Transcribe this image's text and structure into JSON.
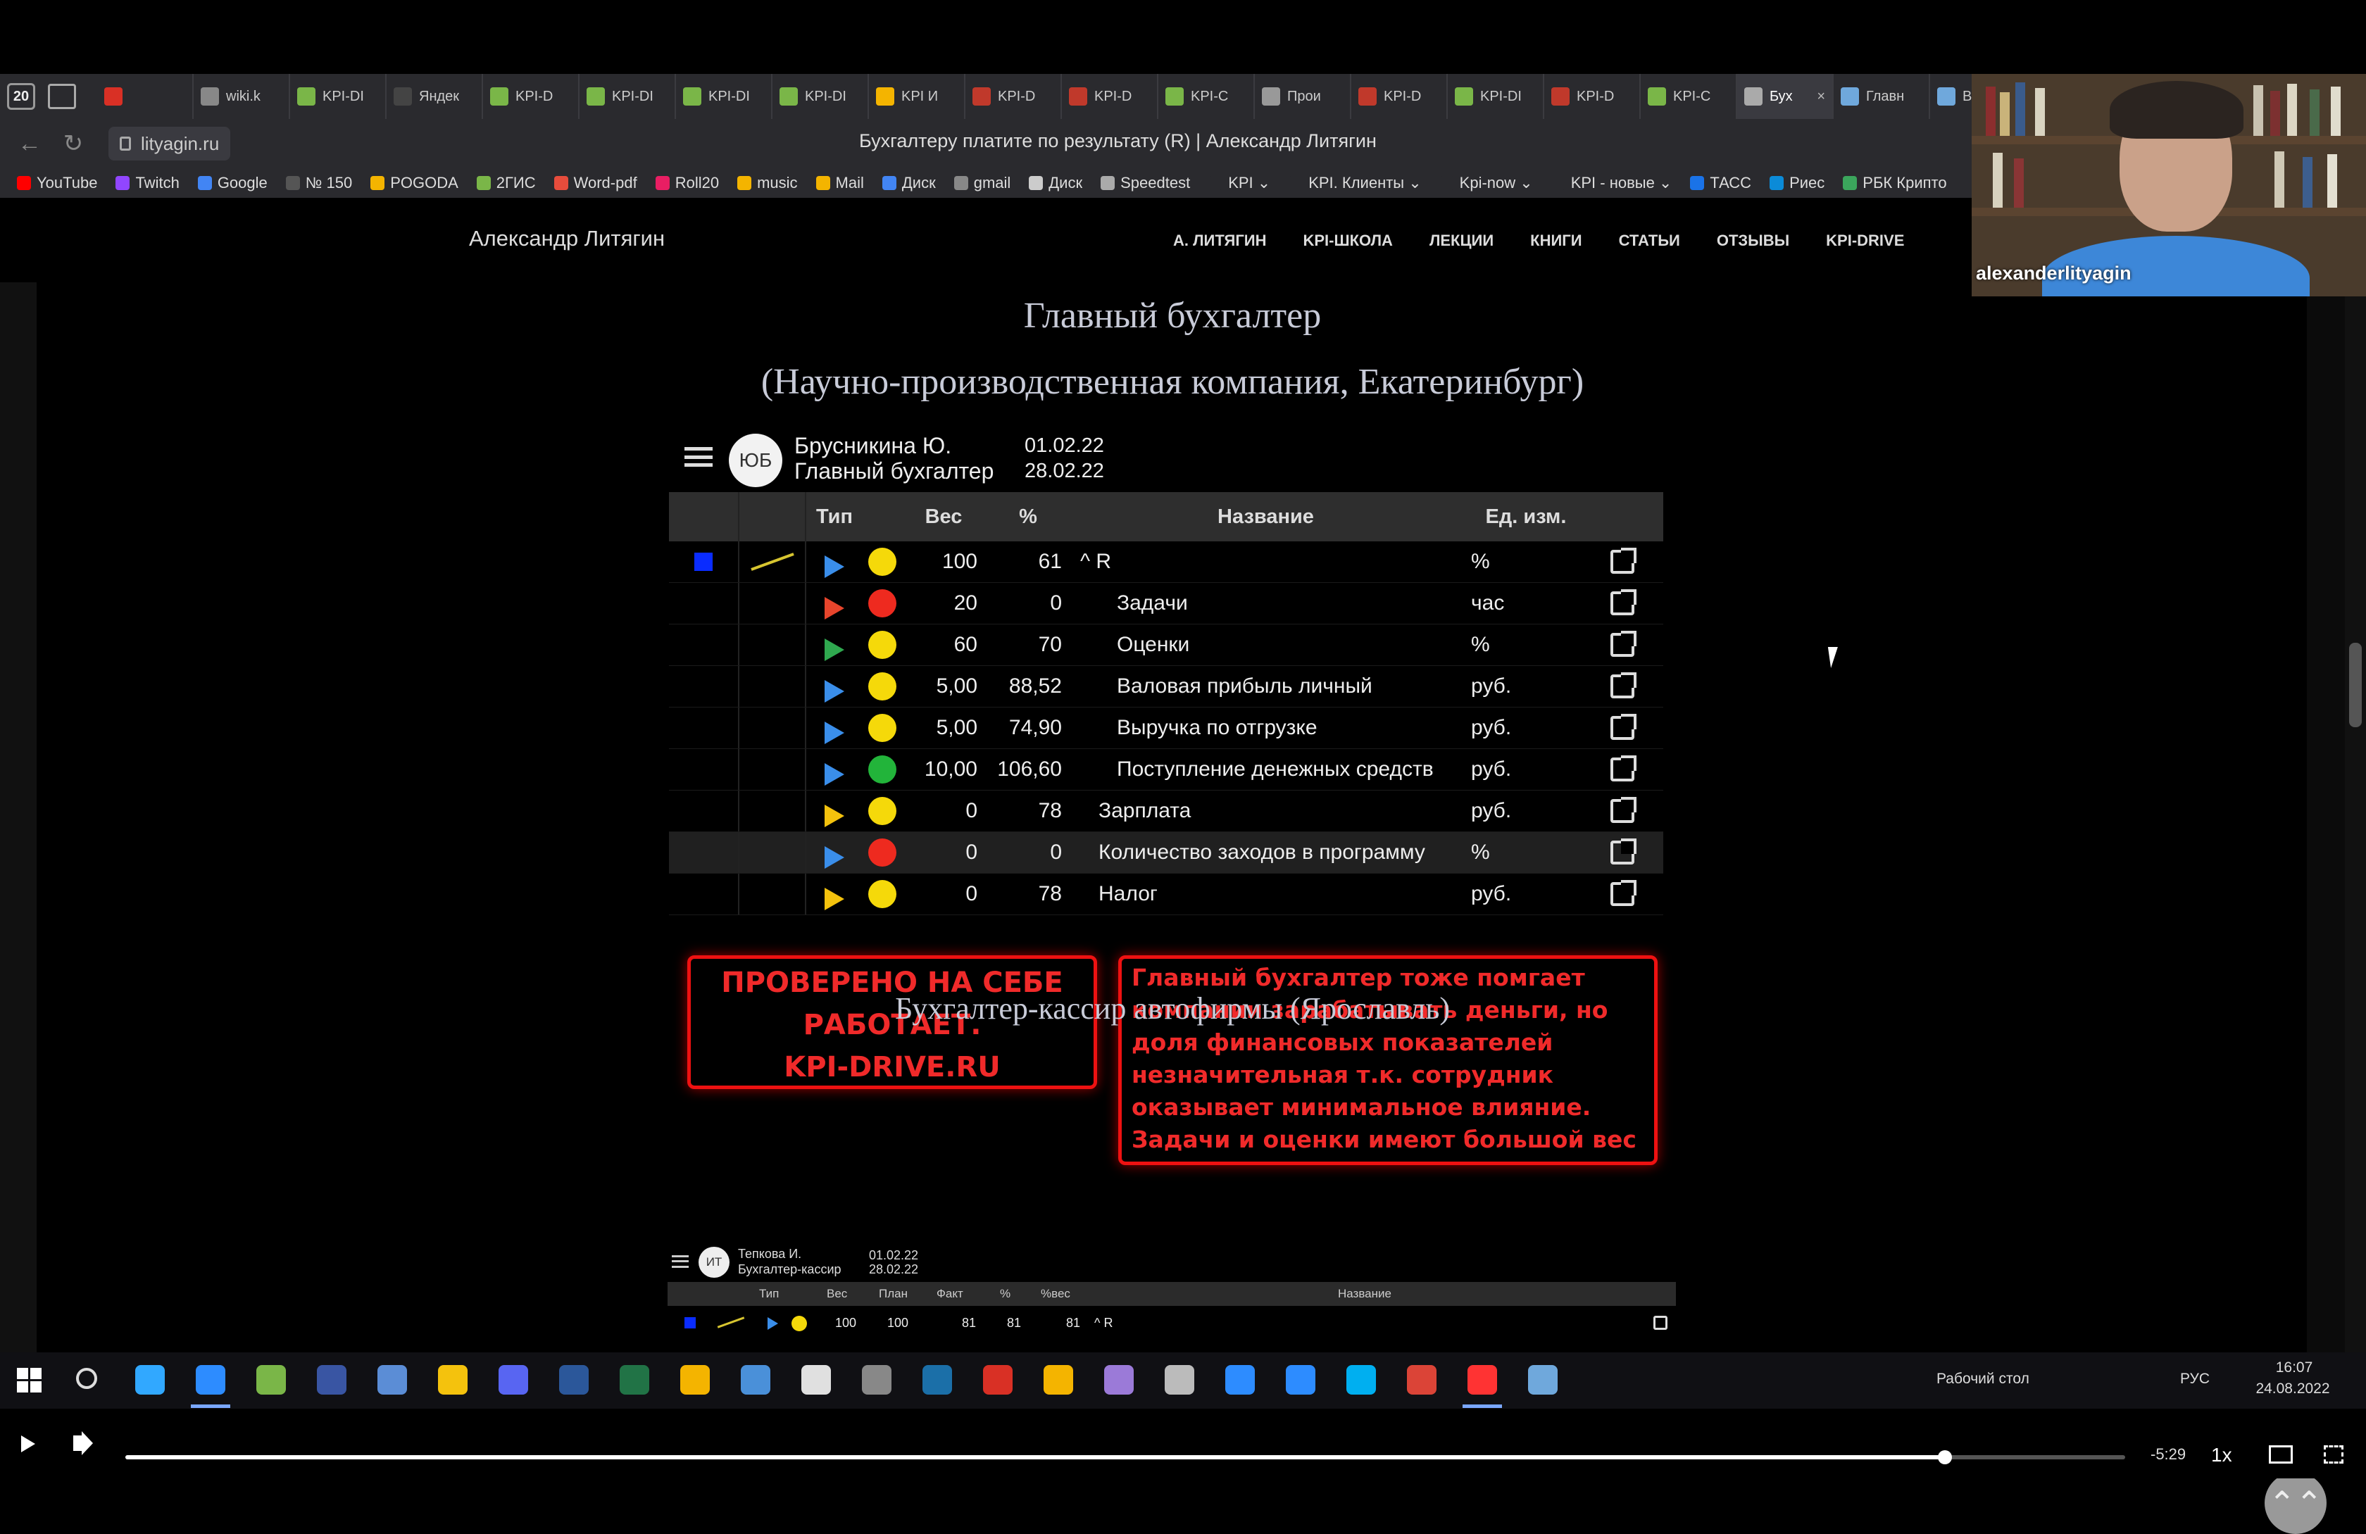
{
  "browser": {
    "tab_count": "20",
    "tabs": [
      {
        "label": "",
        "color": "#d93025"
      },
      {
        "label": "wiki.k",
        "color": "#888888"
      },
      {
        "label": "KPI-DI",
        "color": "#7ab648"
      },
      {
        "label": "Яндек",
        "color": "#444444"
      },
      {
        "label": "KPI-D",
        "color": "#7ab648"
      },
      {
        "label": "KPI-DI",
        "color": "#7ab648"
      },
      {
        "label": "KPI-DI",
        "color": "#7ab648"
      },
      {
        "label": "KPI-DI",
        "color": "#7ab648"
      },
      {
        "label": "KPI И",
        "color": "#f4b400"
      },
      {
        "label": "KPI-D",
        "color": "#c0392b"
      },
      {
        "label": "KPI-D",
        "color": "#c0392b"
      },
      {
        "label": "KPI-C",
        "color": "#7ab648"
      },
      {
        "label": "Прои",
        "color": "#999999"
      },
      {
        "label": "KPI-D",
        "color": "#c0392b"
      },
      {
        "label": "KPI-DI",
        "color": "#7ab648"
      },
      {
        "label": "KPI-D",
        "color": "#c0392b"
      },
      {
        "label": "KPI-C",
        "color": "#7ab648"
      },
      {
        "label": "Бух",
        "color": "#aaaaaa",
        "active": true
      },
      {
        "label": "Главн",
        "color": "#6fa8dc"
      },
      {
        "label": "ВЕБИ",
        "color": "#6fa8dc"
      }
    ],
    "close_glyph": "×",
    "url": "lityagin.ru",
    "page_title": "Бухгалтеру платите по результату (R) | Александр Литягин",
    "bookmarks": [
      {
        "label": "YouTube",
        "color": "#ff0000"
      },
      {
        "label": "Twitch",
        "color": "#9146ff"
      },
      {
        "label": "Google",
        "color": "#4285f4"
      },
      {
        "label": "№ 150",
        "color": "#555555"
      },
      {
        "label": "POGODA",
        "color": "#f4b400"
      },
      {
        "label": "2ГИС",
        "color": "#7ab648"
      },
      {
        "label": "Word-pdf",
        "color": "#e74c3c"
      },
      {
        "label": "Roll20",
        "color": "#e91e63"
      },
      {
        "label": "music",
        "color": "#f4b400"
      },
      {
        "label": "Mail",
        "color": "#f4b400"
      },
      {
        "label": "Диск",
        "color": "#4285f4"
      },
      {
        "label": "gmail",
        "color": "#888888"
      },
      {
        "label": "Диск",
        "color": "#cccccc"
      },
      {
        "label": "Speedtest",
        "color": "#aaaaaa"
      },
      {
        "label": "KPI ⌄",
        "color": "#2a2a2e"
      },
      {
        "label": "KPI. Клиенты ⌄",
        "color": "#2a2a2e"
      },
      {
        "label": "Kpi-now ⌄",
        "color": "#2a2a2e"
      },
      {
        "label": "KPI - новые ⌄",
        "color": "#2a2a2e"
      },
      {
        "label": "ТАСС",
        "color": "#1a73e8"
      },
      {
        "label": "Риес",
        "color": "#0b8bd8"
      },
      {
        "label": "РБК Крипто",
        "color": "#3ba55c"
      }
    ]
  },
  "site": {
    "brand": "Александр Литягин",
    "nav": [
      "А. ЛИТЯГИН",
      "KPI-ШКОЛА",
      "ЛЕКЦИИ",
      "КНИГИ",
      "СТАТЬИ",
      "ОТЗЫВЫ",
      "KPI-DRIVE"
    ],
    "heading1": "Главный бухгалтер",
    "heading2": "(Научно-производственная компания, Екатеринбург)",
    "card1": {
      "avatar": "ЮБ",
      "name": "Брусникина Ю.",
      "role": "Главный бухгалтер",
      "date_from": "01.02.22",
      "date_to": "28.02.22",
      "columns": {
        "type": "Тип",
        "weight": "Вес",
        "percent": "%",
        "name": "Название",
        "unit": "Ед. изм."
      },
      "rows": [
        {
          "weight": "100",
          "percent": "61",
          "name": "^ R",
          "unit": "%",
          "indent": 0,
          "play": "#3a8eea",
          "dot": "#f5d90a",
          "root": true
        },
        {
          "weight": "20",
          "percent": "0",
          "name": "Задачи",
          "unit": "час",
          "indent": 2,
          "play": "#e8452c",
          "dot": "#ee2a1f"
        },
        {
          "weight": "60",
          "percent": "70",
          "name": "Оценки",
          "unit": "%",
          "indent": 2,
          "play": "#2fa84f",
          "dot": "#f5d90a"
        },
        {
          "weight": "5,00",
          "percent": "88,52",
          "name": "Валовая прибыль личный",
          "unit": "руб.",
          "indent": 2,
          "play": "#3a8eea",
          "dot": "#f5d90a"
        },
        {
          "weight": "5,00",
          "percent": "74,90",
          "name": "Выручка по отгрузке",
          "unit": "руб.",
          "indent": 2,
          "play": "#3a8eea",
          "dot": "#f5d90a"
        },
        {
          "weight": "10,00",
          "percent": "106,60",
          "name": "Поступление денежных средств",
          "unit": "руб.",
          "indent": 2,
          "play": "#3a8eea",
          "dot": "#22b43a"
        },
        {
          "weight": "0",
          "percent": "78",
          "name": "Зарплата",
          "unit": "руб.",
          "indent": 1,
          "play": "#f4c20d",
          "dot": "#f5d90a"
        },
        {
          "weight": "0",
          "percent": "0",
          "name": "Количество заходов в программу",
          "unit": "%",
          "indent": 1,
          "play": "#3a8eea",
          "dot": "#ee2a1f",
          "highlight": true
        },
        {
          "weight": "0",
          "percent": "78",
          "name": "Налог",
          "unit": "руб.",
          "indent": 1,
          "play": "#f4c20d",
          "dot": "#f5d90a"
        }
      ]
    },
    "stamp_lines": [
      "ПРОВЕРЕНО НА СЕБЕ",
      "РАБОТАЕТ.",
      "KPI-DRIVE.RU"
    ],
    "note_lines": [
      "Главный бухгалтер тоже помгает",
      "компании зарабатывать деньги, но",
      "доля финансовых показателей",
      "незначительная т.к. сотрудник",
      "оказывает минимальное влияние.",
      "Задачи и оценки имеют большой вес"
    ],
    "heading3": "Бухгалтер-кассир автофирмы (Ярославль)",
    "card2": {
      "avatar": "ИТ",
      "name": "Тепкова И.",
      "role": "Бухгалтер-кассир",
      "date_from": "01.02.22",
      "date_to": "28.02.22",
      "columns": {
        "type": "Тип",
        "weight": "Вес",
        "plan": "План",
        "fact": "Факт",
        "percent": "%",
        "pweight": "%вес",
        "name": "Название"
      },
      "row": {
        "weight": "100",
        "plan": "100",
        "fact": "81",
        "percent": "81",
        "pweight": "81",
        "name": "^ R"
      }
    },
    "back_to_top": "⌃⌃"
  },
  "webcam": {
    "name": "alexanderlityagin"
  },
  "taskbar": {
    "desktop_label": "Рабочий стол",
    "language": "РУС",
    "time": "16:07",
    "date": "24.08.2022",
    "apps": [
      {
        "name": "photoshop",
        "color": "#31a8ff"
      },
      {
        "name": "zoom",
        "color": "#2d8cff"
      },
      {
        "name": "utorrent",
        "color": "#7ab648"
      },
      {
        "name": "visio",
        "color": "#3955a3"
      },
      {
        "name": "terminal",
        "color": "#5b8dd6"
      },
      {
        "name": "explorer",
        "color": "#f4c20d"
      },
      {
        "name": "discord",
        "color": "#5865f2"
      },
      {
        "name": "word",
        "color": "#2b579a"
      },
      {
        "name": "excel",
        "color": "#217346"
      },
      {
        "name": "drive",
        "color": "#f4b400"
      },
      {
        "name": "monitor",
        "color": "#4a90d9"
      },
      {
        "name": "paint",
        "color": "#e0e0e0"
      },
      {
        "name": "steam-alt",
        "color": "#888888"
      },
      {
        "name": "steam",
        "color": "#1b6fa8"
      },
      {
        "name": "game",
        "color": "#d93025"
      },
      {
        "name": "tool",
        "color": "#f4b400"
      },
      {
        "name": "vs",
        "color": "#9b7ad8"
      },
      {
        "name": "gallery",
        "color": "#bbbbbb"
      },
      {
        "name": "snip",
        "color": "#2d8cff"
      },
      {
        "name": "edge",
        "color": "#2d8cff"
      },
      {
        "name": "skype",
        "color": "#00aff0"
      },
      {
        "name": "chrome",
        "color": "#db4437"
      },
      {
        "name": "yandex",
        "color": "#ff3333"
      },
      {
        "name": "notes",
        "color": "#6fa8dc"
      }
    ]
  },
  "player": {
    "remaining": "-5:29",
    "speed": "1x",
    "progress": 0.91
  }
}
